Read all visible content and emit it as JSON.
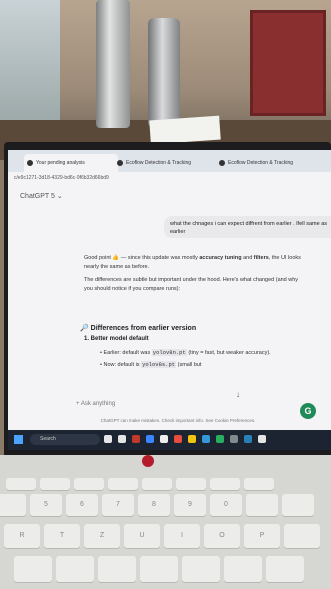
{
  "browser": {
    "tabs": [
      {
        "label": "Your pending analysis"
      },
      {
        "label": "Ecoflow Detection & Tracking"
      },
      {
        "label": "Ecoflow Detection & Tracking"
      }
    ],
    "url": "c/e9c1271-3d18-4329-bd6c-9f6b32d66bd9"
  },
  "chat": {
    "model_label": "ChatGPT 5 ⌄",
    "user_message": "what the chnages i can expect diffrent from earlier . Ifell same as earlier",
    "reply_p1_prefix": "Good point 👍 — since this update was mostly ",
    "reply_p1_bold1": "accuracy tuning",
    "reply_p1_and": " and ",
    "reply_p1_bold2": "filters",
    "reply_p1_suffix": ", the UI looks",
    "reply_p1_line2": "nearly the same as before.",
    "reply_p2_line1": "The differences are subtle but important under the hood. Here's what changed (and why",
    "reply_p2_line2": "you should notice if you compare runs):",
    "section_icon": "🔎",
    "section_heading": "Differences from earlier version",
    "item_heading": "1.  Better model default",
    "bullet1_prefix": "Earlier: default was ",
    "bullet1_code": "yolov8n.pt",
    "bullet1_suffix": " (tiny = fast, but weaker accuracy).",
    "bullet2_prefix": "Now: default is ",
    "bullet2_code": "yolov8s.pt",
    "bullet2_suffix": " (small but",
    "input_placeholder": "+   Ask anything",
    "footer": "ChatGPT can make mistakes. Check important info. See Cookie Preferences.",
    "badge_letter": "G"
  },
  "taskbar": {
    "search_placeholder": "Search"
  },
  "keyboard": {
    "row1": [
      "",
      "",
      "",
      "",
      "",
      "",
      "",
      ""
    ],
    "row2": [
      "",
      "5",
      "6",
      "7",
      "8",
      "9",
      "0",
      "",
      ""
    ],
    "row3": [
      "R",
      "T",
      "Z",
      "U",
      "I",
      "O",
      "P",
      ""
    ],
    "row4": [
      "",
      "",
      "",
      "",
      "",
      "",
      "",
      ""
    ]
  }
}
